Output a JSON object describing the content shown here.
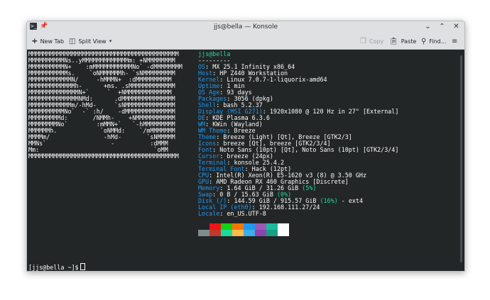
{
  "window": {
    "title": "jjs@bella — Konsole"
  },
  "toolbar": {
    "new_tab": "New Tab",
    "split_view": "Split View",
    "copy": "Copy",
    "paste": "Paste",
    "find": "Find..."
  },
  "terminal": {
    "art": [
      "MMMMMMMMMMMMMMMMMMMMMMMMMMMMMMMMMMMMMMMMMM",
      "MMMMMMMMMMNs..yMMMMMMMMMMMMMm: +NMMMMMMMM",
      "MMMMMMMMMMN+    :mMMMMMMMMMMMNo` -dMMMMMMMM",
      "MMMMMMMMMMMs.    `oNMMMMMMh- `sNMMMMMMMMM",
      "MMMMMMMMMMMMN/     -hMMMN+  :dMMMMMMMMMM",
      "MMMMMMMMMMMMMh-      +ms. .sMMMMMMMMMMMMM",
      "MMMMMMMMMMMMMMN+`     `  +NMMMMMMMMMMMMM",
      "MMMMMMMMMMMMMMNMd:      .dMMMMMMMMMMMMMMM",
      "MMMMMMMMMMMMm/-hMd-     `sNMMMMMMMMMMMMMM",
      "MMMMMMMMMMNo`  -` :h/    -dMMMMMMMMMMMMMM",
      "MMMMMMMMMd:       /NMMh-    +NMMMMMMMMMMM",
      "MMMMMMMMNo`        :mMMN+`   `-hMMMMMMMMM",
      "MMMMMMh.            `oNMMd:    `/mMMMMMMM",
      "MMMMm/               -hMd-       `sNMMMMM",
      "MMNs`                  -          :dMMM",
      "Mm:                                `oMM",
      "MMMMMMMMMMMMMMMMMMMMMMMMMMMMMMMMMMMMMMMMMM"
    ],
    "user_host": "jjs@bella",
    "separator": "---------",
    "info": [
      {
        "key": "OS",
        "value": "MX 25.1 Infinity x86_64"
      },
      {
        "key": "Host",
        "value": "HP Z440 Workstation"
      },
      {
        "key": "Kernel",
        "value": "Linux 7.0.7-1-liquorix-amd64"
      },
      {
        "key": "Uptime",
        "value": "1 min"
      },
      {
        "key": "OS Age",
        "value": "93 days"
      },
      {
        "key": "Packages",
        "value": "3056 (dpkg)"
      },
      {
        "key": "Shell",
        "value": "bash 5.2.37"
      },
      {
        "key": "Display (MSI G271)",
        "value": "1920x1080 @ 120 Hz in 27\" [External]"
      },
      {
        "key": "DE",
        "value": "KDE Plasma 6.3.6"
      },
      {
        "key": "WM",
        "value": "KWin (Wayland)"
      },
      {
        "key": "WM Theme",
        "value": "Breeze"
      },
      {
        "key": "Theme",
        "value": "Breeze (Light) [Qt], Breeze [GTK2/3]"
      },
      {
        "key": "Icons",
        "value": "breeze [Qt], breeze [GTK2/3/4]"
      },
      {
        "key": "Font",
        "value": "Noto Sans (10pt) [Qt], Noto Sans (10pt) [GTK2/3/4]"
      },
      {
        "key": "Cursor",
        "value": "breeze (24px)"
      },
      {
        "key": "Terminal",
        "value": "konsole 25.4.2"
      },
      {
        "key": "Terminal Font",
        "value": "Hack (12pt)"
      },
      {
        "key": "CPU",
        "value": "Intel(R) Xeon(R) E5-1620 v3 (8) @ 3.50 GHz"
      },
      {
        "key": "GPU",
        "value": "AMD Radeon RX 460 Graphics [Discrete]"
      },
      {
        "key": "Memory",
        "value": "1.64 GiB / 31.26 GiB",
        "pct": "(5%)",
        "suffix": ""
      },
      {
        "key": "Swap",
        "value": "0 B / 15.63 GiB",
        "pct": "(0%)",
        "suffix": ""
      },
      {
        "key": "Disk (/)",
        "value": "144.59 GiB / 915.57 GiB",
        "pct": "(16%)",
        "suffix": " - ext4"
      },
      {
        "key": "Local IP (eth0)",
        "value": "192.168.111.27/24"
      },
      {
        "key": "Locale",
        "value": "en_US.UTF-8"
      }
    ],
    "palette_top": [
      "#232627",
      "#ed1515",
      "#11d116",
      "#f67400",
      "#1d99f3",
      "#9b59b6",
      "#1abc9c",
      "#fcfcfc"
    ],
    "palette_bottom": [
      "#7f8c8d",
      "#c0392b",
      "#1cdc9a",
      "#fdbc4b",
      "#3daee9",
      "#8e44ad",
      "#16a085",
      "#ffffff"
    ],
    "prompt": "[jjs@bella ~]$"
  },
  "colors": {
    "terminal_bg": "#232627",
    "key_blue": "#1d99f3",
    "accent_green": "#1cdc9a"
  }
}
